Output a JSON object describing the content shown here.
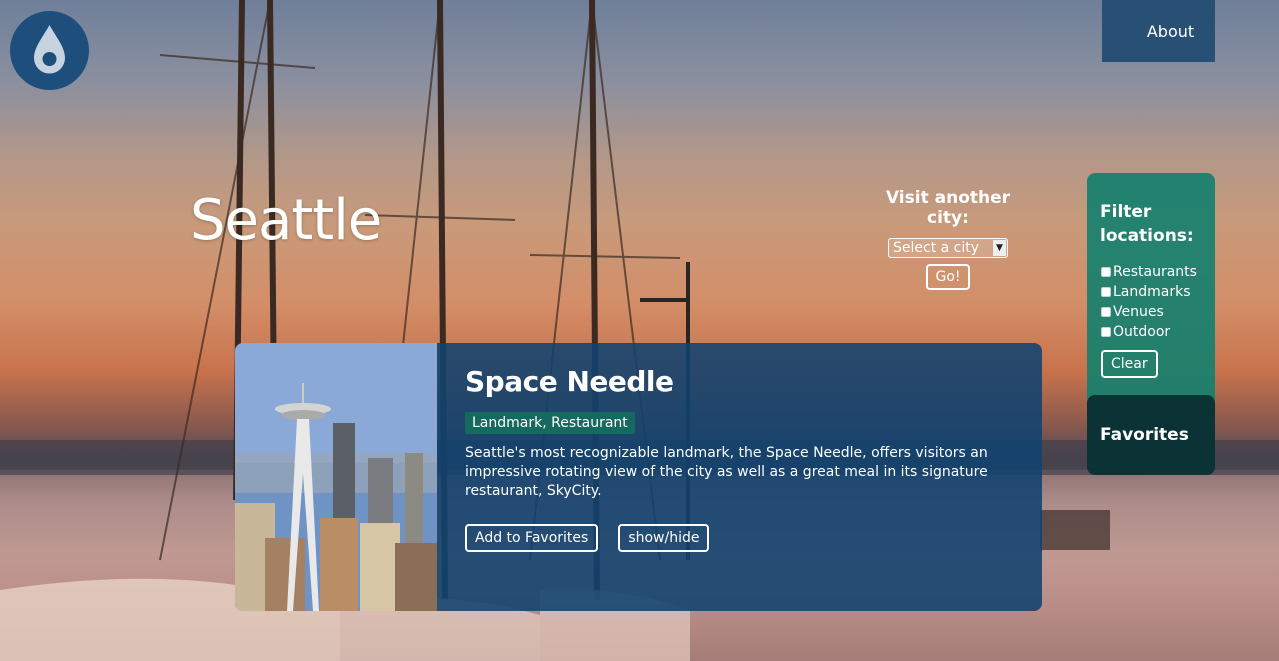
{
  "header": {
    "logo_icon": "water-drop-icon",
    "about_label": "About"
  },
  "city": {
    "name": "Seattle"
  },
  "visit": {
    "label": "Visit another city:",
    "select_value": "Select a city",
    "go_label": "Go!"
  },
  "filter": {
    "title": "Filter locations:",
    "options": [
      "Restaurants",
      "Landmarks",
      "Venues",
      "Outdoor"
    ],
    "clear_label": "Clear"
  },
  "favorites": {
    "title": "Favorites"
  },
  "card": {
    "title": "Space Needle",
    "tags": "Landmark, Restaurant",
    "description": "Seattle's most recognizable landmark, the Space Needle, offers visitors an impressive rotating view of the city as well as a great meal in its signature restaurant, SkyCity.",
    "add_favorites_label": "Add to Favorites",
    "toggle_label": "show/hide"
  },
  "colors": {
    "logo": "#1e4f7c",
    "nav": "#284f74",
    "filter_panel": "#16806e",
    "favorites_panel": "#0a2d32",
    "card": "#104270",
    "tag": "#16695f"
  }
}
